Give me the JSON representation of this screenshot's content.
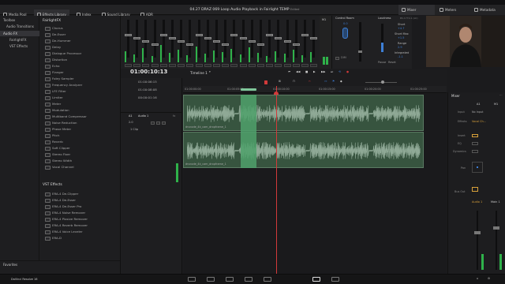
{
  "menu": [
    "DaVinci Resolve",
    "File",
    "Edit",
    "Trim",
    "Timeline",
    "Clip",
    "Mark",
    "View",
    "Playback",
    "Fusion",
    "Color",
    "Fairlight",
    "Workspace",
    "Help"
  ],
  "toolbar": {
    "media_pool": "Media Pool",
    "effects_library": "Effects Library",
    "index": "Index",
    "sound_library": "Sound Library",
    "adr": "ADR",
    "project_title": "04.27 DRAZ 069 Loop Audio Playback in Fairlight TEMP",
    "edited": "Edited",
    "mixer": "Mixer",
    "meters": "Meters",
    "metadata": "Metadata"
  },
  "tree": {
    "items": [
      "Toolbox",
      "Audio Transitions",
      "Audio FX",
      "FairlightFX",
      "VST Effects"
    ]
  },
  "fx": {
    "section1": "FairlightFX",
    "section2": "VST Effects",
    "items": [
      "Chorus",
      "De-Esser",
      "De-Hummer",
      "Delay",
      "Dialogue Processor",
      "Distortion",
      "Echo",
      "Flanger",
      "Foley Sampler",
      "Frequency Analyzer",
      "LFE Filter",
      "Limiter",
      "Meter",
      "Modulation",
      "Multiband Compressor",
      "Noise Reduction",
      "Phase Meter",
      "Pitch",
      "Reverb",
      "Soft Clipper",
      "Stereo Fixer",
      "Stereo Width",
      "Vocal Channel"
    ],
    "vst_items": [
      "ERA-4 De-Clipper",
      "ERA-4 De-Esser",
      "ERA-4 De-Esser Pro",
      "ERA-4 Noise Remover",
      "ERA-4 Plosive Remover",
      "ERA-4 Reverb Remover",
      "ERA-4 Voice Leveler",
      "ERA-D"
    ]
  },
  "favorites": "Favorites",
  "control_room": {
    "title": "Control Room",
    "m1": "M1",
    "dim": "DIM",
    "value": "0.0"
  },
  "loudness": {
    "title": "Loudness",
    "standard": "BS.1770-1 (LU)",
    "short_max_label": "Short Max",
    "short_max": "+1.5",
    "range_label": "Range",
    "range": "2.9",
    "integrated_label": "Integrated",
    "integrated": "-1.1",
    "short_label": "Short",
    "short": "+4.7",
    "pause": "Pause",
    "reset": "Reset"
  },
  "timeline": {
    "timecode": "01:00:10:13",
    "name": "Timeline 1",
    "tc_rows": [
      "01:00:06:15",
      "01:00:08:08",
      "00:00:01:16"
    ],
    "track_id": "A1",
    "track_name": "Audio 1",
    "track_fmt": "2.0",
    "clip_count": "1 Clip",
    "ruler": [
      "01:00:00:00",
      "01:00:05:00",
      "01:00:10:00",
      "01:00:15:00",
      "01:00:20:00",
      "01:00:25:00"
    ],
    "clip_name": "drvcode_4k_cam_dropframe_1"
  },
  "mixer": {
    "title": "Mixer",
    "col1": "A1",
    "col2": "M1",
    "rows": [
      "Input",
      "Effects",
      "Insert",
      "EQ",
      "Dynamics",
      "Pan",
      "Bus Out"
    ],
    "input_val": "No Input",
    "effects_val": "Vocal Ch...",
    "ch1": "Audio 1",
    "ch2": "Main 1"
  },
  "bottom": {
    "app": "DaVinci Resolve 16"
  },
  "colors": {
    "accent_green": "#2fb24a",
    "clip_green": "#37543f",
    "selection": "#4fa16b",
    "playhead": "#d23a3a",
    "accent_blue": "#3d7fd6"
  }
}
